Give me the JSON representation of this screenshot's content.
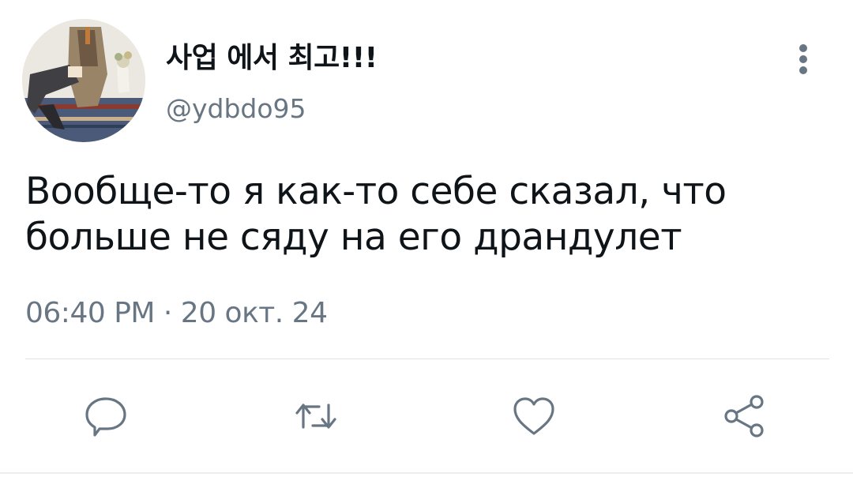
{
  "user": {
    "display_name": "사업 에서 최고!!!",
    "handle": "@ydbdo95"
  },
  "tweet": {
    "text": "Вообще-то я как-то себе сказал, что\nбольше не сяду на его драндулет",
    "timestamp": "06:40 PM · 20 окт. 24"
  },
  "actions": [
    {
      "name": "reply",
      "icon": "speech-bubble-icon"
    },
    {
      "name": "retweet",
      "icon": "retweet-icon"
    },
    {
      "name": "like",
      "icon": "heart-icon"
    },
    {
      "name": "share",
      "icon": "share-icon"
    }
  ],
  "colors": {
    "text_primary": "#0f1419",
    "text_secondary": "#687684",
    "icon": "#687684",
    "divider": "#dfe3e7"
  }
}
